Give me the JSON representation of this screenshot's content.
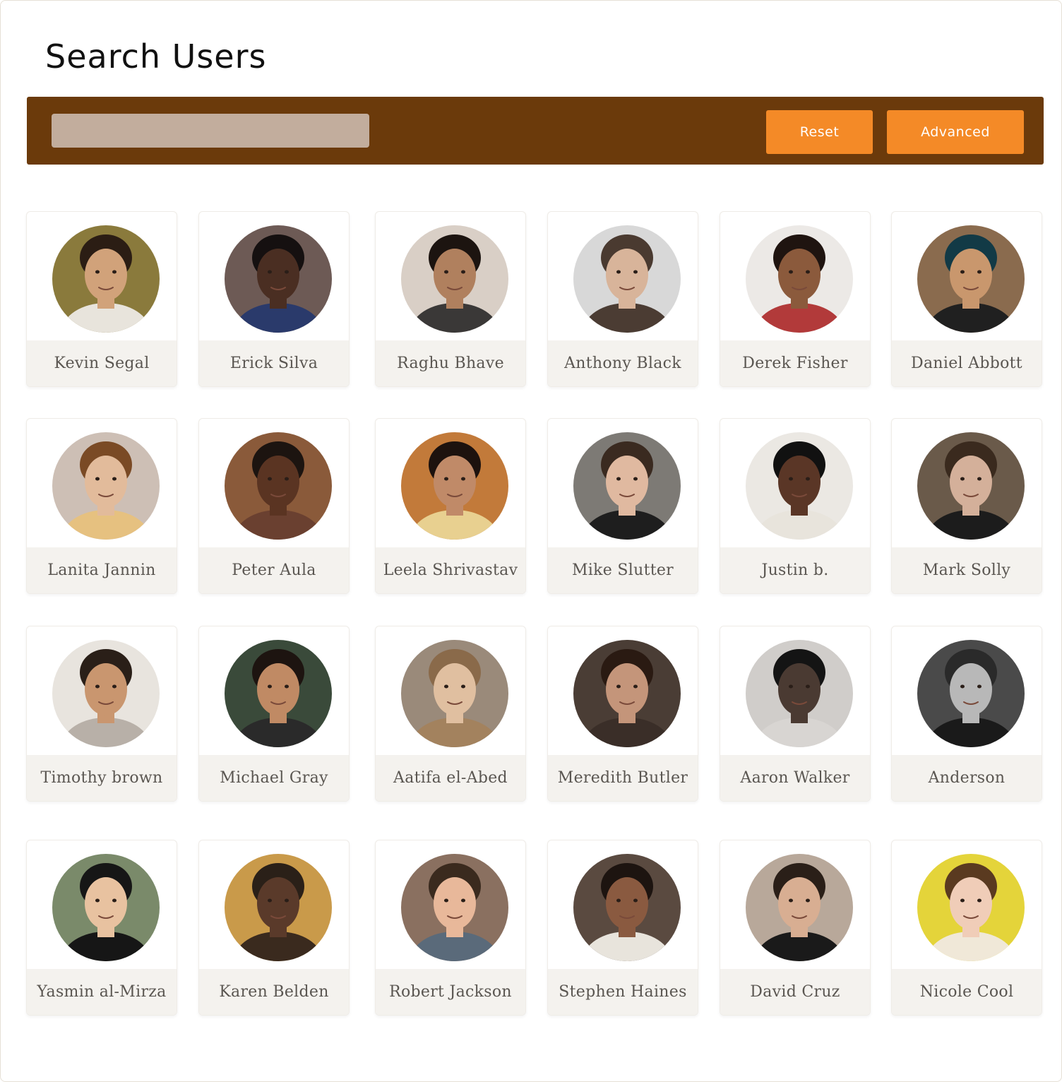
{
  "page": {
    "title": "Search Users"
  },
  "search": {
    "value": "",
    "placeholder": ""
  },
  "toolbar": {
    "reset_label": "Reset",
    "advanced_label": "Advanced"
  },
  "colors": {
    "toolbar_bg": "#6b3a0b",
    "button_bg": "#f48a27",
    "search_bg": "#c2ad9d"
  },
  "users": [
    {
      "name": "Kevin Segal",
      "bg": "#8a7a3c",
      "skin": "#d1a27a",
      "hair": "#2b1d14",
      "shirt": "#e8e4dc"
    },
    {
      "name": "Erick Silva",
      "bg": "#6d5a55",
      "skin": "#4a2e22",
      "hair": "#151010",
      "shirt": "#2a3a6b"
    },
    {
      "name": "Raghu Bhave",
      "bg": "#d9cfc6",
      "skin": "#b0805e",
      "hair": "#1c1410",
      "shirt": "#3a3837"
    },
    {
      "name": "Anthony Black",
      "bg": "#d8d8d8",
      "skin": "#d8b49a",
      "hair": "#4a3a30",
      "shirt": "#4b3c33"
    },
    {
      "name": "Derek Fisher",
      "bg": "#ece9e6",
      "skin": "#8b5a3c",
      "hair": "#1f1410",
      "shirt": "#b23a3a"
    },
    {
      "name": "Daniel Abbott",
      "bg": "#8a6b4e",
      "skin": "#c9976d",
      "hair": "#123a46",
      "shirt": "#202020"
    },
    {
      "name": "Lanita Jannin",
      "bg": "#cdbfb5",
      "skin": "#e2bb9b",
      "hair": "#7a4a25",
      "shirt": "#e6c180"
    },
    {
      "name": "Peter Aula",
      "bg": "#8a5a3a",
      "skin": "#5a3422",
      "hair": "#1c1410",
      "shirt": "#6a4030"
    },
    {
      "name": "Leela Shrivastav",
      "bg": "#c27a3a",
      "skin": "#c08a68",
      "hair": "#1d120e",
      "shirt": "#e8d090"
    },
    {
      "name": "Mike Slutter",
      "bg": "#7d7a75",
      "skin": "#e0b9a0",
      "hair": "#3a2a20",
      "shirt": "#1e1e1e"
    },
    {
      "name": "Justin b.",
      "bg": "#ebe8e3",
      "skin": "#5a3626",
      "hair": "#111111",
      "shirt": "#e8e4dc"
    },
    {
      "name": "Mark Solly",
      "bg": "#6a5a4a",
      "skin": "#d4b09a",
      "hair": "#3a2a1e",
      "shirt": "#1c1c1c"
    },
    {
      "name": "Timothy brown",
      "bg": "#e8e4de",
      "skin": "#c9966f",
      "hair": "#2a1f18",
      "shirt": "#b8b0a8"
    },
    {
      "name": "Michael Gray",
      "bg": "#3a4a3a",
      "skin": "#c08a64",
      "hair": "#1d1410",
      "shirt": "#2a2a2a"
    },
    {
      "name": "Aatifa el-Abed",
      "bg": "#9a8a7a",
      "skin": "#e0bfa0",
      "hair": "#8a6a4a",
      "shirt": "#a3825e"
    },
    {
      "name": "Meredith Butler",
      "bg": "#4a3d35",
      "skin": "#c4957a",
      "hair": "#2a1a12",
      "shirt": "#3a2e28"
    },
    {
      "name": "Aaron Walker",
      "bg": "#d0cdca",
      "skin": "#4a3a32",
      "hair": "#141414",
      "shirt": "#d8d5d2"
    },
    {
      "name": "Anderson",
      "bg": "#4a4a4a",
      "skin": "#b8b8b8",
      "hair": "#2a2a2a",
      "shirt": "#1a1a1a"
    },
    {
      "name": "Yasmin al-Mirza",
      "bg": "#7a8a6a",
      "skin": "#e8c2a0",
      "hair": "#161616",
      "shirt": "#161616"
    },
    {
      "name": "Karen Belden",
      "bg": "#c99a4a",
      "skin": "#5a3a2a",
      "hair": "#2a2018",
      "shirt": "#3a2a1e"
    },
    {
      "name": "Robert Jackson",
      "bg": "#8a7060",
      "skin": "#e8b89a",
      "hair": "#3a2a1e",
      "shirt": "#5a6a7a"
    },
    {
      "name": "Stephen Haines",
      "bg": "#5a4a40",
      "skin": "#8a5a40",
      "hair": "#1d1410",
      "shirt": "#e8e4dc"
    },
    {
      "name": "David Cruz",
      "bg": "#b8a89a",
      "skin": "#d8ae92",
      "hair": "#2a1f18",
      "shirt": "#1a1a1a"
    },
    {
      "name": "Nicole Cool",
      "bg": "#e4d43a",
      "skin": "#f0cdb8",
      "hair": "#5a3a20",
      "shirt": "#f0e8d8"
    }
  ]
}
